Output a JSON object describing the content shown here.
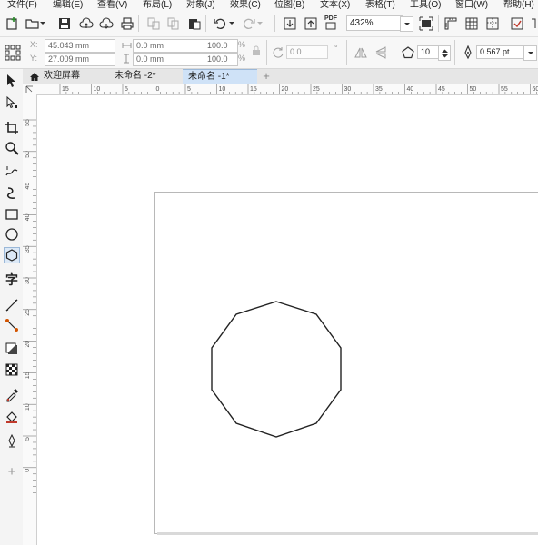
{
  "menu": [
    {
      "label": "文件(F)"
    },
    {
      "label": "编辑(E)"
    },
    {
      "label": "查看(V)"
    },
    {
      "label": "布局(L)"
    },
    {
      "label": "对象(J)"
    },
    {
      "label": "效果(C)"
    },
    {
      "label": "位图(B)"
    },
    {
      "label": "文本(X)"
    },
    {
      "label": "表格(T)"
    },
    {
      "label": "工具(O)"
    },
    {
      "label": "窗口(W)"
    },
    {
      "label": "帮助(H)"
    }
  ],
  "toolbar": {
    "pdf_label": "PDF",
    "zoom_value": "432%"
  },
  "property_bar": {
    "x_label": "X:",
    "y_label": "Y:",
    "x_value": "45.043 mm",
    "y_value": "27.009 mm",
    "width_value": "0.0 mm",
    "height_value": "0.0 mm",
    "scale_x": "100.0",
    "scale_y": "100.0",
    "percent": "%",
    "rotation_value": "0.0",
    "degree": "°",
    "polygon_sides": "10",
    "outline_width": "0.567 pt"
  },
  "tabs": [
    {
      "label": "欢迎屏幕"
    },
    {
      "label": "未命名 -2*"
    },
    {
      "label": "未命名 -1*"
    }
  ],
  "add_tab_glyph": "+",
  "hruler_ticks": [
    "15",
    "10",
    "5",
    "0",
    "5",
    "10",
    "15",
    "20",
    "25",
    "30",
    "35",
    "40",
    "45",
    "50",
    "55",
    "60"
  ],
  "vruler_ticks": [
    "55",
    "50",
    "45",
    "40",
    "35",
    "30",
    "25",
    "20",
    "15",
    "10",
    "5",
    "0"
  ],
  "colors": {
    "active_tab": "#cfe2f7",
    "canvas": "#ffffff",
    "workspace": "#f0f0f0"
  }
}
